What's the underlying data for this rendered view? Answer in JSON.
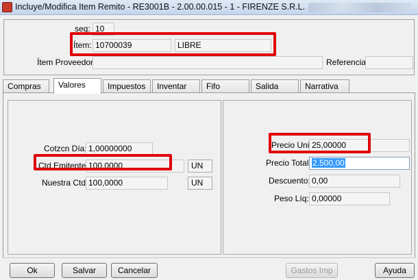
{
  "window": {
    "title": "Incluye/Modifica Item Remito - RE3001B - 2.00.00.015 - 1 - FIRENZE S.R.L."
  },
  "header": {
    "seq_label": "seq:",
    "seq_value": "10",
    "item_label": "Ítem:",
    "item_code": "10700039",
    "item_desc": "LIBRE",
    "proveedor_label": "Ítem Proveedor:",
    "proveedor_value": "",
    "referencia_label": "Referencia:",
    "referencia_value": ""
  },
  "tabs": [
    {
      "label": "Compras"
    },
    {
      "label": "Valores"
    },
    {
      "label": "Impuestos"
    },
    {
      "label": "Inventar"
    },
    {
      "label": "Fifo"
    },
    {
      "label": "Salida"
    },
    {
      "label": "Narrativa"
    }
  ],
  "valores": {
    "cotzcn_label": "Cotzcn Día:",
    "cotzcn_value": "1,00000000",
    "ctd_emitente_label": "Ctd Emitente:",
    "ctd_emitente_value": "100,0000",
    "ctd_emitente_unit": "UN",
    "nuestra_label": "Nuestra Ctd:",
    "nuestra_value": "100,0000",
    "nuestra_unit": "UN",
    "precio_unit_label": "Precio Unit:",
    "precio_unit_value": "25,00000",
    "precio_total_label": "Precio Total:",
    "precio_total_value": "2.500,00",
    "descuento_label": "Descuento:",
    "descuento_value": "0,00",
    "peso_label": "Peso Líq:",
    "peso_value": "0,00000"
  },
  "footer": {
    "ok": "Ok",
    "salvar": "Salvar",
    "cancelar": "Cancelar",
    "gastos": "Gastos Imp",
    "ayuda": "Ayuda"
  },
  "colors": {
    "highlight": "#e0000a",
    "selection": "#3399ff"
  }
}
